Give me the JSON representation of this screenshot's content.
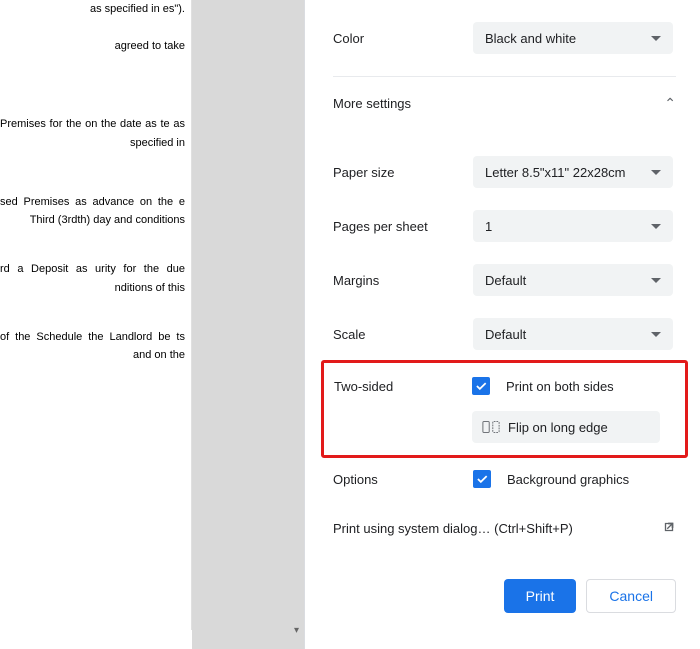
{
  "preview": {
    "p1": "as specified in es\").",
    "p2": "agreed to take",
    "p3": "Premises for the on the date as te as specified in",
    "p4": "sed Premises as advance on the e Third (3rdth) day and conditions",
    "p5": "rd a Deposit as urity for the due nditions of this",
    "p6": "of the Schedule the Landlord be ts and on the"
  },
  "panel": {
    "color": {
      "label": "Color",
      "value": "Black and white"
    },
    "more_settings": "More settings",
    "paper_size": {
      "label": "Paper size",
      "value": "Letter 8.5\"x11\" 22x28cm"
    },
    "pages_per_sheet": {
      "label": "Pages per sheet",
      "value": "1"
    },
    "margins": {
      "label": "Margins",
      "value": "Default"
    },
    "scale": {
      "label": "Scale",
      "value": "Default"
    },
    "two_sided": {
      "label": "Two-sided",
      "checkbox_label": "Print on both sides",
      "flip_value": "Flip on long edge"
    },
    "options": {
      "label": "Options",
      "checkbox_label": "Background graphics"
    },
    "system_dialog": {
      "text": "Print using system dialog…",
      "shortcut": "(Ctrl+Shift+P)"
    },
    "buttons": {
      "print": "Print",
      "cancel": "Cancel"
    }
  }
}
